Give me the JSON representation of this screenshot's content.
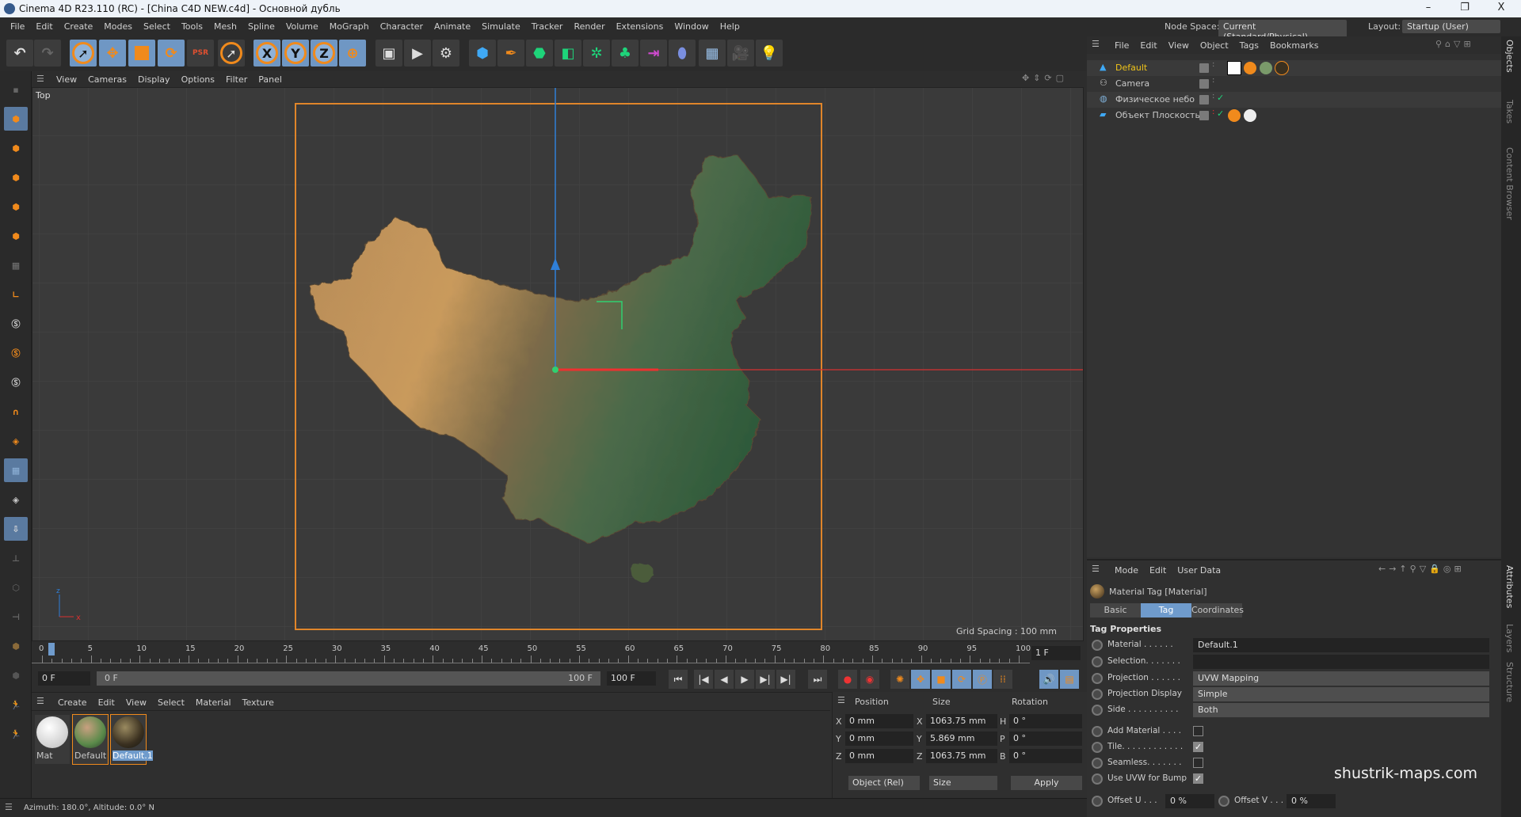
{
  "window": {
    "title": "Cinema 4D R23.110 (RC) - [China C4D NEW.c4d] - Основной дубль",
    "minimize": "–",
    "maximize": "❐",
    "close": "X"
  },
  "menu": [
    "File",
    "Edit",
    "Create",
    "Modes",
    "Select",
    "Tools",
    "Mesh",
    "Spline",
    "Volume",
    "MoGraph",
    "Character",
    "Animate",
    "Simulate",
    "Tracker",
    "Render",
    "Extensions",
    "Window",
    "Help"
  ],
  "node_space": {
    "label": "Node Space:",
    "value": "Current (Standard/Physical)"
  },
  "layout": {
    "label": "Layout:",
    "value": "Startup (User)"
  },
  "viewport": {
    "menu": [
      "View",
      "Cameras",
      "Display",
      "Options",
      "Filter",
      "Panel"
    ],
    "camera_label": "Top",
    "grid_spacing": "Grid Spacing : 100 mm"
  },
  "object_manager": {
    "menu": [
      "File",
      "Edit",
      "View",
      "Object",
      "Tags",
      "Bookmarks"
    ],
    "objects": [
      {
        "name": "Default",
        "active": true
      },
      {
        "name": "Camera"
      },
      {
        "name": "Физическое небо"
      },
      {
        "name": "Объект Плоскость"
      }
    ]
  },
  "side_tabs": [
    "Objects",
    "Takes",
    "Content Browser",
    "Attributes",
    "Layers",
    "Structure"
  ],
  "attributes": {
    "menu": [
      "Mode",
      "Edit",
      "User Data"
    ],
    "title": "Material Tag [Material]",
    "tabs": [
      "Basic",
      "Tag",
      "Coordinates"
    ],
    "active_tab": "Tag",
    "section": "Tag Properties",
    "material_label": "Material . . . . . .",
    "material": "Default.1",
    "selection_label": "Selection. . . . . . .",
    "selection": "",
    "projection_label": "Projection . . . . . .",
    "projection": "UVW Mapping",
    "projection_display_label": "Projection Display",
    "projection_display": "Simple",
    "side_label": "Side . . . . . . . . . .",
    "side": "Both",
    "add_material_label": "Add Material . . . .",
    "add_material": false,
    "tile_label": "Tile. . . . . . . . . . . .",
    "tile": true,
    "seamless_label": "Seamless. . . . . . .",
    "seamless": false,
    "use_uvw_label": "Use UVW for Bump",
    "use_uvw": true,
    "offset_u_label": "Offset U . . .",
    "offset_u": "0 %",
    "offset_v_label": "Offset V . . .",
    "offset_v": "0 %"
  },
  "watermark": "shustrik-maps.com",
  "timeline": {
    "ticks": [
      "0",
      "5",
      "10",
      "15",
      "20",
      "25",
      "30",
      "35",
      "40",
      "45",
      "50",
      "55",
      "60",
      "65",
      "70",
      "75",
      "80",
      "85",
      "90",
      "95",
      "100"
    ],
    "current_frame": "1",
    "frame_field": "1 F",
    "start": "0 F",
    "range_start": "0 F",
    "range_end": "100 F",
    "end": "100 F"
  },
  "material_manager": {
    "menu": [
      "Create",
      "Edit",
      "View",
      "Select",
      "Material",
      "Texture"
    ],
    "materials": [
      {
        "name": "Mat"
      },
      {
        "name": "Default"
      },
      {
        "name": "Default.1",
        "selected": true
      }
    ]
  },
  "coordinates": {
    "headers": [
      "Position",
      "Size",
      "Rotation"
    ],
    "rows": [
      {
        "pl": "X",
        "p": "0 mm",
        "sl": "X",
        "s": "1063.75 mm",
        "rl": "H",
        "r": "0 °"
      },
      {
        "pl": "Y",
        "p": "0 mm",
        "sl": "Y",
        "s": "5.869 mm",
        "rl": "P",
        "r": "0 °"
      },
      {
        "pl": "Z",
        "p": "0 mm",
        "sl": "Z",
        "s": "1063.75 mm",
        "rl": "B",
        "r": "0 °"
      }
    ],
    "mode": "Object (Rel)",
    "size_mode": "Size",
    "apply": "Apply"
  },
  "status": "Azimuth: 180.0°, Altitude: 0.0°  N"
}
